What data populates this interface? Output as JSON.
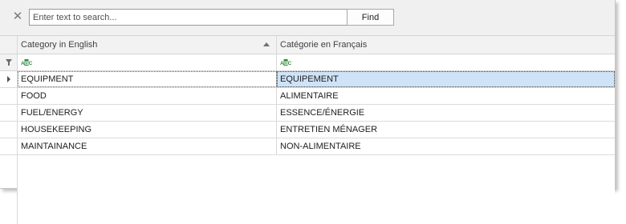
{
  "search": {
    "placeholder": "Enter text to search...",
    "value": "",
    "find_label": "Find",
    "close_icon": "close-icon"
  },
  "grid": {
    "columns": [
      {
        "label": "Category in English",
        "sort": "ascending"
      },
      {
        "label": "Catégorie en Français",
        "sort": "none"
      }
    ],
    "filter_row": {
      "icon": "filter-icon",
      "cell_icon": "abc-text-filter-icon"
    },
    "rows": [
      {
        "english": "EQUIPMENT",
        "french": "EQUIPEMENT"
      },
      {
        "english": "FOOD",
        "french": "ALIMENTAIRE"
      },
      {
        "english": "FUEL/ENERGY",
        "french": "ESSENCE/ÉNERGIE"
      },
      {
        "english": "HOUSEKEEPING",
        "french": "ENTRETIEN MÉNAGER"
      },
      {
        "english": "MAINTAINANCE",
        "french": "NON-ALIMENTAIRE"
      }
    ],
    "focused_row": 0,
    "focused_column": 1
  },
  "colors": {
    "selection": "#cfe3f7",
    "header_bg": "#f2f2f2",
    "gridline": "#dcdcdc",
    "abc_green": "#2e8b3a"
  }
}
